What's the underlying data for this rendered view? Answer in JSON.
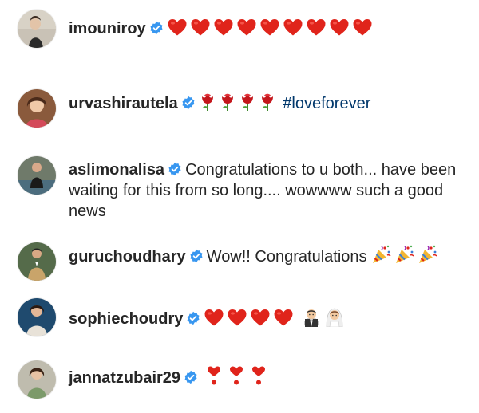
{
  "colors": {
    "text": "#262626",
    "verified_badge": "#3897f0",
    "heart": "#e0241b",
    "hashtag": "#00376b"
  },
  "comments": [
    {
      "username": "imouniroy",
      "verified": true,
      "text": "",
      "emoji": [
        "heart",
        "heart",
        "heart",
        "heart",
        "heart",
        "heart",
        "heart",
        "heart",
        "heart"
      ]
    },
    {
      "username": "urvashirautela",
      "verified": true,
      "text": "",
      "emoji": [
        "rose",
        "rose",
        "rose",
        "rose"
      ],
      "hashtag": "#loveforever"
    },
    {
      "username": "aslimonalisa",
      "verified": true,
      "text": "Congratulations to u both... have been waiting for this from so long.... wowwww such a good news",
      "emoji": []
    },
    {
      "username": "guruchoudhary",
      "verified": true,
      "text": "Wow!! Congratulations",
      "emoji": [
        "party-popper",
        "party-popper",
        "party-popper"
      ]
    },
    {
      "username": "sophiechoudry",
      "verified": true,
      "text": "",
      "emoji": [
        "heart",
        "heart",
        "heart",
        "heart",
        "man-in-tuxedo",
        "bride-with-veil"
      ]
    },
    {
      "username": "jannatzubair29",
      "verified": true,
      "text": "",
      "emoji": [
        "heavy-heart-exclamation",
        "heavy-heart-exclamation",
        "heavy-heart-exclamation"
      ]
    }
  ]
}
